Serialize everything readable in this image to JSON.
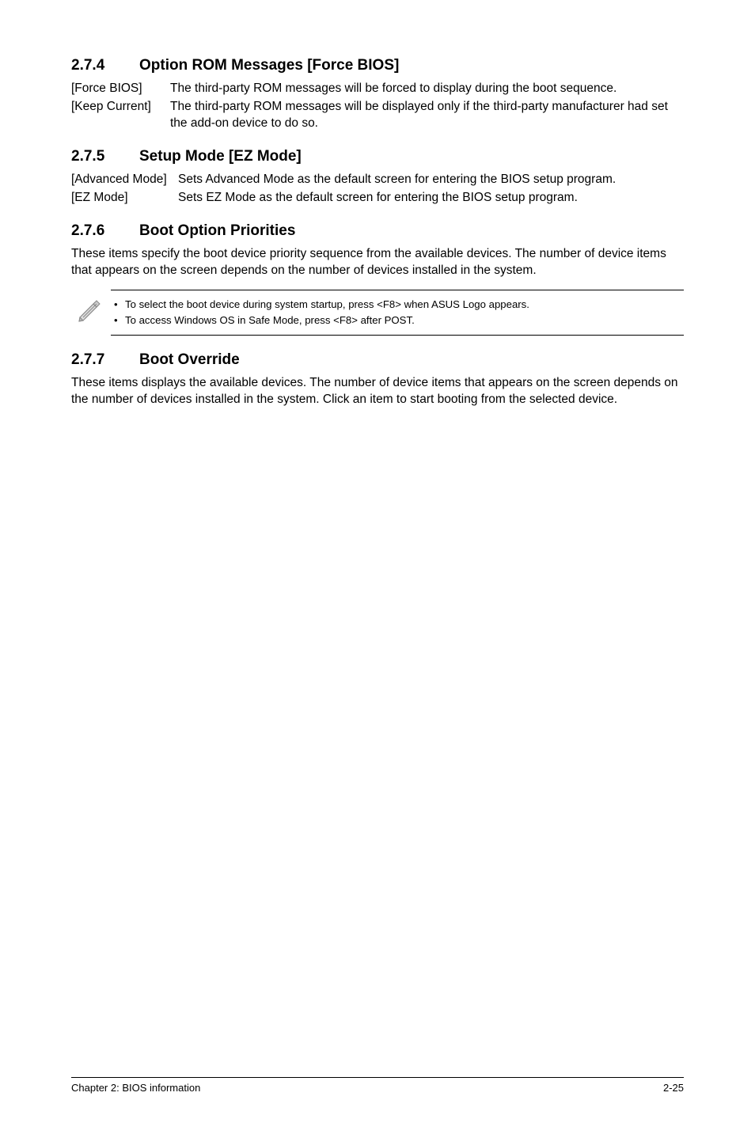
{
  "sections": {
    "s274": {
      "num": "2.7.4",
      "title": "Option ROM Messages [Force BIOS]",
      "defs": [
        {
          "term": "[Force BIOS]",
          "desc": "The third-party ROM messages will be forced to display during the boot sequence."
        },
        {
          "term": "[Keep Current]",
          "desc": "The third-party ROM messages will be displayed only if the third-party manufacturer had set the add-on device to do so."
        }
      ]
    },
    "s275": {
      "num": "2.7.5",
      "title": "Setup Mode [EZ Mode]",
      "defs": [
        {
          "term": "[Advanced Mode]",
          "desc": "Sets Advanced Mode as the default screen for entering the BIOS setup program."
        },
        {
          "term": "[EZ Mode]",
          "desc": "Sets EZ Mode as the default screen for entering the BIOS setup program."
        }
      ]
    },
    "s276": {
      "num": "2.7.6",
      "title": "Boot Option Priorities",
      "para": "These items specify the boot device priority sequence from the available devices. The number of device items that appears on the screen depends on the number of devices installed in the system.",
      "notes": [
        "To select the boot device during system startup, press <F8> when ASUS Logo appears.",
        "To access Windows OS in Safe Mode, press <F8> after POST."
      ]
    },
    "s277": {
      "num": "2.7.7",
      "title": "Boot Override",
      "para": "These items displays the available devices. The number of device items that appears on the screen depends on the number of devices installed in the system. Click an item to start booting from the selected device."
    }
  },
  "footer": {
    "left": "Chapter 2: BIOS information",
    "right": "2-25"
  }
}
